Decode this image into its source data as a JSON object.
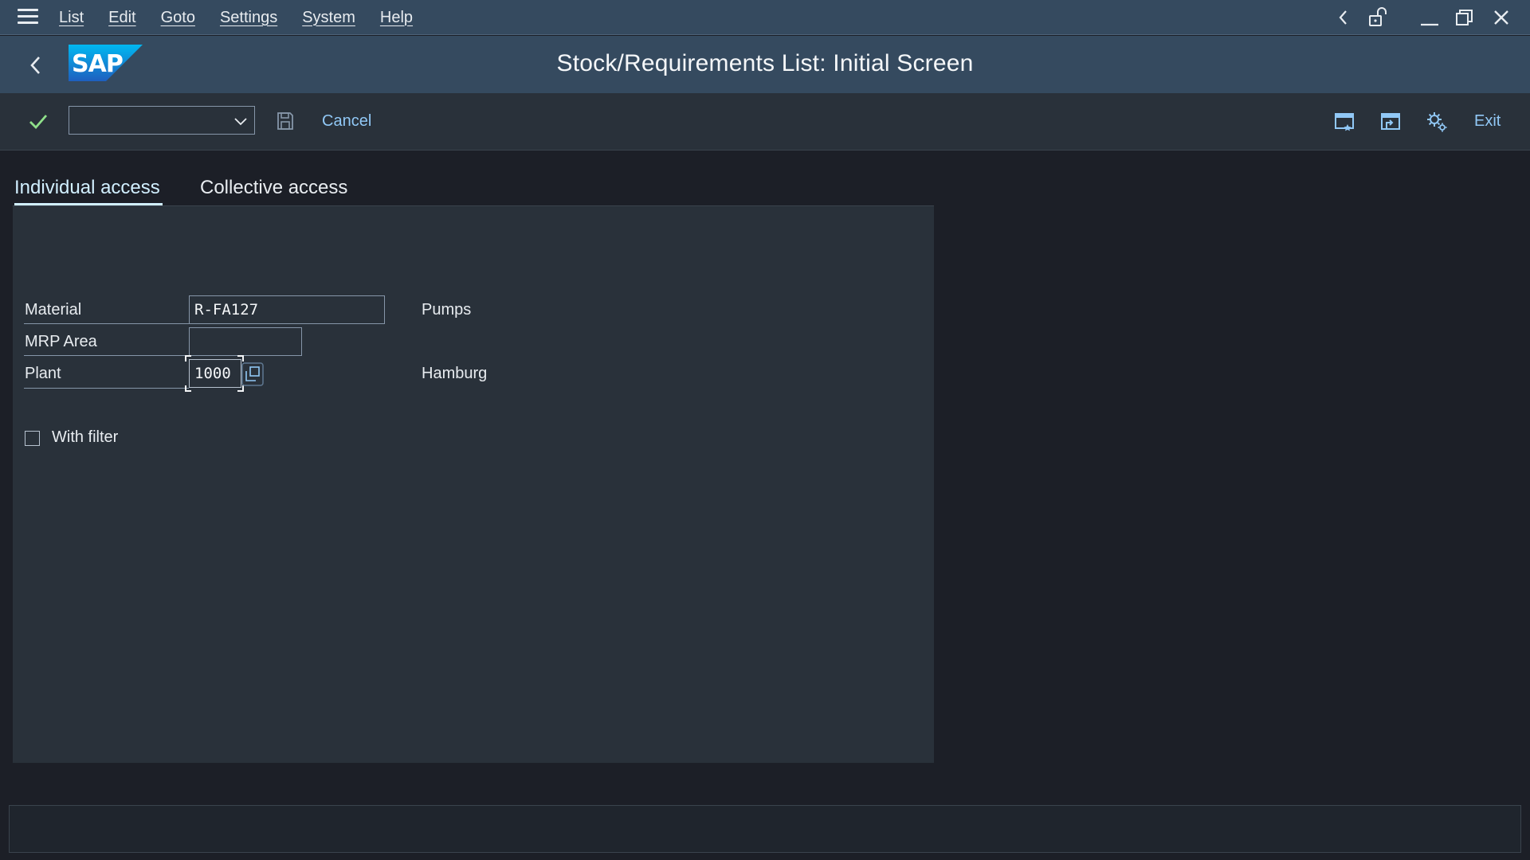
{
  "menu": {
    "items": [
      "List",
      "Edit",
      "Goto",
      "Settings",
      "System",
      "Help"
    ]
  },
  "title": "Stock/Requirements List: Initial Screen",
  "toolbar": {
    "command_value": "",
    "cancel_label": "Cancel",
    "exit_label": "Exit"
  },
  "tabs": {
    "individual": "Individual access",
    "collective": "Collective access",
    "active": "individual"
  },
  "form": {
    "material": {
      "label": "Material",
      "value": "R-FA127",
      "description": "Pumps"
    },
    "mrp_area": {
      "label": "MRP Area",
      "value": ""
    },
    "plant": {
      "label": "Plant",
      "value": "1000",
      "description": "Hamburg"
    },
    "with_filter": {
      "label": "With filter",
      "checked": false
    }
  },
  "status": ""
}
